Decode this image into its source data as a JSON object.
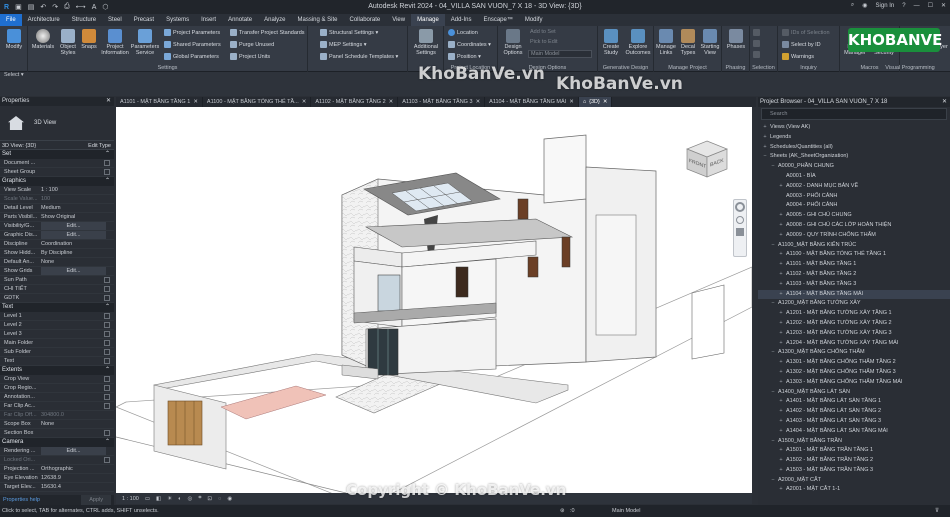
{
  "title": "Autodesk Revit 2024 - 04_VILLA SAN VUON_7 X 18 - 3D View: {3D}",
  "signin": "Sign In",
  "menu": [
    "File",
    "Architecture",
    "Structure",
    "Steel",
    "Precast",
    "Systems",
    "Insert",
    "Annotate",
    "Analyze",
    "Massing & Site",
    "Collaborate",
    "View",
    "Manage",
    "Add-Ins",
    "Enscape™",
    "Modify"
  ],
  "ribbon": {
    "modify": "Modify",
    "select": "Select ▾",
    "materials": "Materials",
    "object_styles": "Object Styles",
    "snaps": "Snaps",
    "project_information": "Project Information",
    "parameters_service": "Parameters Service",
    "project_parameters": "Project Parameters",
    "shared_parameters": "Shared Parameters",
    "global_parameters": "Global Parameters",
    "transfer_standards": "Transfer Project Standards",
    "purge_unused": "Purge Unused",
    "project_units": "Project Units",
    "structural_settings": "Structural Settings ▾",
    "mep_settings": "MEP Settings ▾",
    "panel_schedule_templates": "Panel Schedule Templates ▾",
    "additional_settings": "Additional Settings",
    "location": "Location",
    "coordinates": "Coordinates ▾",
    "position": "Position ▾",
    "design_options": "Design Options",
    "add_to_set": "Add to Set",
    "pick_to_edit": "Pick to Edit",
    "main_model": "Main Model",
    "create_study": "Create Study",
    "explore_outcomes": "Explore Outcomes",
    "manage_links": "Manage Links",
    "decal_types": "Decal Types",
    "starting_view": "Starting View",
    "phases": "Phases",
    "ids_of_selection": "IDs of Selection",
    "select_by_id": "Select by ID",
    "warnings": "Warnings",
    "macro_manager": "Macro Manager",
    "macro_security": "Macro Security",
    "dynamo_player": "Dynamo Player",
    "groups": {
      "settings": "Settings",
      "project_location": "Project Location",
      "design_options": "Design Options",
      "generative_design": "Generative Design",
      "manage_project": "Manage Project",
      "phasing": "Phasing",
      "selection": "Selection",
      "inquiry": "Inquiry",
      "macros": "Macros",
      "visual_programming": "Visual Programming"
    }
  },
  "properties": {
    "title": "Properties",
    "type": "3D View",
    "selector": "3D View: {3D}",
    "edit_type": "Edit Type",
    "sections": {
      "set": "Set",
      "graphics": "Graphics",
      "text": "Text",
      "extents": "Extents",
      "camera": "Camera"
    },
    "set_rows": [
      [
        "Document ...",
        ""
      ],
      [
        "Sheet Group",
        ""
      ]
    ],
    "graphics_rows": [
      [
        "View Scale",
        "1 : 100"
      ],
      [
        "Scale Value...",
        "100"
      ],
      [
        "Detail Level",
        "Medium"
      ],
      [
        "Parts Visibil...",
        "Show Original"
      ],
      [
        "Visibility/G...",
        "Edit..."
      ],
      [
        "Graphic Dis...",
        "Edit..."
      ],
      [
        "Discipline",
        "Coordination"
      ],
      [
        "Show Hidd...",
        "By Discipline"
      ],
      [
        "Default An...",
        "None"
      ],
      [
        "Show Grids",
        "Edit..."
      ],
      [
        "Sun Path",
        ""
      ],
      [
        "CHI TIẾT",
        ""
      ],
      [
        "GDTK",
        ""
      ]
    ],
    "text_rows": [
      [
        "Level 1",
        ""
      ],
      [
        "Level 2",
        ""
      ],
      [
        "Level 3",
        ""
      ],
      [
        "Main Folder",
        ""
      ],
      [
        "Sub Folder",
        ""
      ],
      [
        "Text",
        ""
      ]
    ],
    "extents_rows": [
      [
        "Crop View",
        ""
      ],
      [
        "Crop Regio...",
        ""
      ],
      [
        "Annotation...",
        ""
      ],
      [
        "Far Clip Ac...",
        ""
      ],
      [
        "Far Clip Off...",
        "304800.0"
      ],
      [
        "Scope Box",
        "None"
      ],
      [
        "Section Box",
        ""
      ]
    ],
    "camera_rows": [
      [
        "Rendering ...",
        "Edit..."
      ],
      [
        "Locked Ori...",
        ""
      ],
      [
        "Projection ...",
        "Orthographic"
      ],
      [
        "Eye Elevation",
        "12638.9"
      ],
      [
        "Target Elev...",
        "15630.4"
      ]
    ],
    "help": "Properties help",
    "apply": "Apply"
  },
  "tabs": [
    "A1101 - MẶT BẰNG TẦNG 1",
    "A1100 - MẶT BẰNG TỔNG THỂ TẦ...",
    "A1102 - MẶT BẰNG TẦNG 2",
    "A1103 - MẶT BẰNG TẦNG 3",
    "A1104 - MẶT BẰNG TẦNG MÁI",
    "{3D}"
  ],
  "viewcube": {
    "front": "FRONT",
    "back": "BACK"
  },
  "view_scale": "1 : 100",
  "browser": {
    "title": "Project Browser - 04_VILLA SAN VUON_7 X 18",
    "search_placeholder": "Search",
    "items": [
      [
        "+",
        "Views (View AK)",
        0
      ],
      [
        "+",
        "Legends",
        0
      ],
      [
        "+",
        "Schedules/Quantities (all)",
        0
      ],
      [
        "−",
        "Sheets (AK_SheetOrganization)",
        0
      ],
      [
        "−",
        "A0000_PHẦN CHUNG",
        1
      ],
      [
        "",
        "A0001 - BÌA",
        2
      ],
      [
        "+",
        "A0002 - DANH MỤC BẢN VẼ",
        2
      ],
      [
        "",
        "A0003 - PHỐI CẢNH",
        2
      ],
      [
        "",
        "A0004 - PHỐI CẢNH",
        2
      ],
      [
        "+",
        "A0005 - GHI CHÚ CHUNG",
        2
      ],
      [
        "+",
        "A0008 - GHI CHÚ CÁC LỚP HOÀN THIỆN",
        2
      ],
      [
        "+",
        "A0009 - QUY TRÌNH CHỐNG THẤM",
        2
      ],
      [
        "−",
        "A1100_MẶT BẰNG KIẾN TRÚC",
        1
      ],
      [
        "+",
        "A1100 - MẶT BẰNG TỔNG THỂ TẦNG 1",
        2
      ],
      [
        "+",
        "A1101 - MẶT BẰNG TẦNG 1",
        2
      ],
      [
        "+",
        "A1102 - MẶT BẰNG TẦNG 2",
        2
      ],
      [
        "+",
        "A1103 - MẶT BẰNG TẦNG 3",
        2
      ],
      [
        "+",
        "A1104 - MẶT BẰNG TẦNG MÁI",
        2
      ],
      [
        "−",
        "A1200_MẶT BẰNG TƯỜNG XÂY",
        1
      ],
      [
        "+",
        "A1201 - MẶT BẰNG TƯỜNG XÂY TẦNG 1",
        2
      ],
      [
        "+",
        "A1202 - MẶT BẰNG TƯỜNG XÂY TẦNG 2",
        2
      ],
      [
        "+",
        "A1203 - MẶT BẰNG TƯỜNG XÂY TẦNG 3",
        2
      ],
      [
        "+",
        "A1204 - MẶT BẰNG TƯỜNG XÂY TẦNG MÁI",
        2
      ],
      [
        "−",
        "A1300_MẶT BẰNG CHỐNG THẤM",
        1
      ],
      [
        "+",
        "A1301 - MẶT BẰNG CHỐNG THẤM TẦNG 2",
        2
      ],
      [
        "+",
        "A1302 - MẶT BẰNG CHỐNG THẤM TẦNG 3",
        2
      ],
      [
        "+",
        "A1303 - MẶT BẰNG CHỐNG THẤM TẦNG MÁI",
        2
      ],
      [
        "−",
        "A1400_MẶT BẰNG LÁT SÀN",
        1
      ],
      [
        "+",
        "A1401 - MẶT BẰNG LÁT SÀN TẦNG 1",
        2
      ],
      [
        "+",
        "A1402 - MẶT BẰNG LÁT SÀN TẦNG 2",
        2
      ],
      [
        "+",
        "A1403 - MẶT BẰNG LÁT SÀN TẦNG 3",
        2
      ],
      [
        "+",
        "A1404 - MẶT BẰNG LÁT SÀN TẦNG MÁI",
        2
      ],
      [
        "−",
        "A1500_MẶT BẰNG TRẦN",
        1
      ],
      [
        "+",
        "A1501 - MẶT BẰNG TRẦN TẦNG 1",
        2
      ],
      [
        "+",
        "A1502 - MẶT BẰNG TRẦN TẦNG 2",
        2
      ],
      [
        "+",
        "A1503 - MẶT BẰNG TRẦN TẦNG 3",
        2
      ],
      [
        "−",
        "A2000_MẶT CẮT",
        1
      ],
      [
        "+",
        "A2001 - MẶT CẮT 1-1",
        2
      ]
    ]
  },
  "status": "Click to select, TAB for alternates, CTRL adds, SHIFT unselects.",
  "status_model": "Main Model",
  "status_zero": ":0",
  "watermarks": [
    "KhoBanVe.vn",
    "KhoBanVe.vn",
    "Copyright © KhoBanVe.vn"
  ],
  "logo": "KHOBANVE",
  "colors": {
    "accent": "#1f6fd0",
    "panel": "#2a2e35",
    "ribbon": "#353b45",
    "logo": "#1a8f3c"
  }
}
